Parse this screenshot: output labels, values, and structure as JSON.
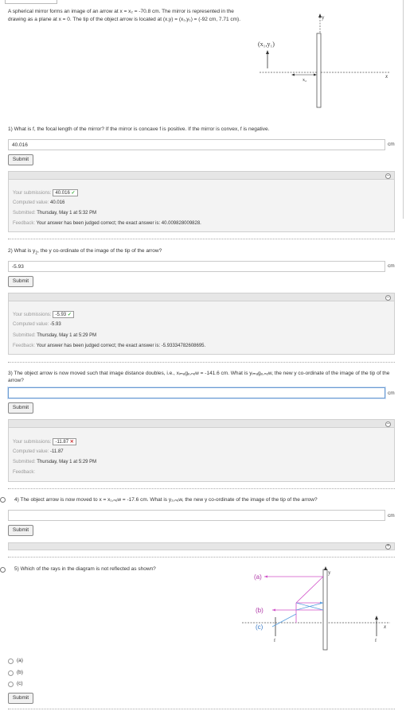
{
  "intro": "A spherical mirror forms an image of an arrow at x = x₂ = -70.8 cm. The mirror is represented in the drawing as a plane at x = 0. The tip of the object arrow is located at (x,y) = (x₁,y₁) = (-92 cm, 7.71 cm).",
  "figure1": {
    "label_xy": "(x₁,y₁)",
    "label_x2": "x₂",
    "axis_y": "y",
    "axis_x": "x"
  },
  "q1": {
    "text": "1) What is f, the focal length of the mirror? If the mirror is concave f is positive. If the mirror is convex, f is negative.",
    "value": "40.016",
    "unit": "cm",
    "submit": "Submit",
    "panel": {
      "sub_label": "Your submissions:",
      "sub_value": "40.016",
      "status": "✓",
      "computed_label": "Computed value:",
      "computed": "40.016",
      "submitted_label": "Submitted:",
      "submitted": "Thursday, May 1 at 5:32 PM",
      "feedback_label": "Feedback:",
      "feedback": "Your answer has been judged correct; the exact answer is: 40.009828009828."
    }
  },
  "q2": {
    "text_pre": "2) What is y",
    "text_sub": "2",
    "text_post": ", the y co-ordinate of the image of the tip of the arrow?",
    "value": "-5.93",
    "unit": "cm",
    "submit": "Submit",
    "panel": {
      "sub_label": "Your submissions:",
      "sub_value": "-5.93",
      "status": "✓",
      "computed_label": "Computed value:",
      "computed": "-5.93",
      "submitted_label": "Submitted:",
      "submitted": "Thursday, May 1 at 5:29 PM",
      "feedback_label": "Feedback:",
      "feedback": "Your answer has been judged correct; the exact answer is: -5.93334782608695."
    }
  },
  "q3": {
    "text": "3) The object arrow is now moved such that image distance doubles, i.e., xᵢₘₐgₑ,ₙₑw = -141.6 cm. What is yᵢₘₐgₑ,ₙₑw, the new y co-ordinate of the image of the tip of the arrow?",
    "value": "",
    "unit": "cm",
    "submit": "Submit",
    "panel": {
      "sub_label": "Your submissions:",
      "sub_value": "-11.87",
      "status": "✕",
      "computed_label": "Computed value:",
      "computed": "-11.87",
      "submitted_label": "Submitted:",
      "submitted": "Thursday, May 1 at 5:29 PM",
      "feedback_label": "Feedback:",
      "feedback": ""
    }
  },
  "q4": {
    "text": "4) The object arrow is now moved to x = x₁,ₙₑw = -17.6 cm. What is y₂,ₙₑw, the new y co-ordinate of the image of the tip of the arrow?",
    "value": "",
    "unit": "cm",
    "submit": "Submit"
  },
  "q5": {
    "text": "5) Which of the rays in the diagram is not reflected as shown?",
    "options": [
      "(a)",
      "(b)",
      "(c)"
    ],
    "submit": "Submit",
    "figure": {
      "a": "(a)",
      "b": "(b)",
      "c": "(c)",
      "f1": "f",
      "f2": "f",
      "axis_y": "y",
      "axis_x": "x"
    }
  },
  "colors": {
    "accent_blue": "#6b9bd2",
    "correct": "#33aa33",
    "incorrect": "#cc3333",
    "ray_magenta": "#d04fc8",
    "ray_blue": "#5aa0e0"
  }
}
